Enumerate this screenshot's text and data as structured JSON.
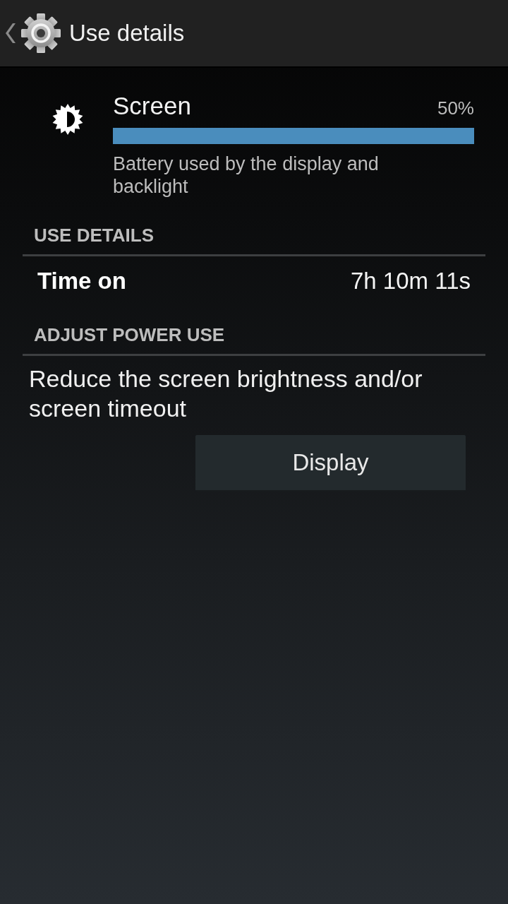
{
  "action_bar": {
    "title": "Use details"
  },
  "summary": {
    "title": "Screen",
    "percent": "50%",
    "level": 1,
    "description": "Battery used by the display and backlight"
  },
  "sections": [
    {
      "header": "USE DETAILS",
      "items": [
        {
          "kind": "row",
          "label": "Time on",
          "value": "7h 10m 11s"
        }
      ]
    },
    {
      "header": "ADJUST POWER USE",
      "items": [
        {
          "kind": "text",
          "text": "Reduce the screen brightness and/or screen timeout"
        },
        {
          "kind": "button",
          "label": "Display"
        }
      ]
    }
  ]
}
